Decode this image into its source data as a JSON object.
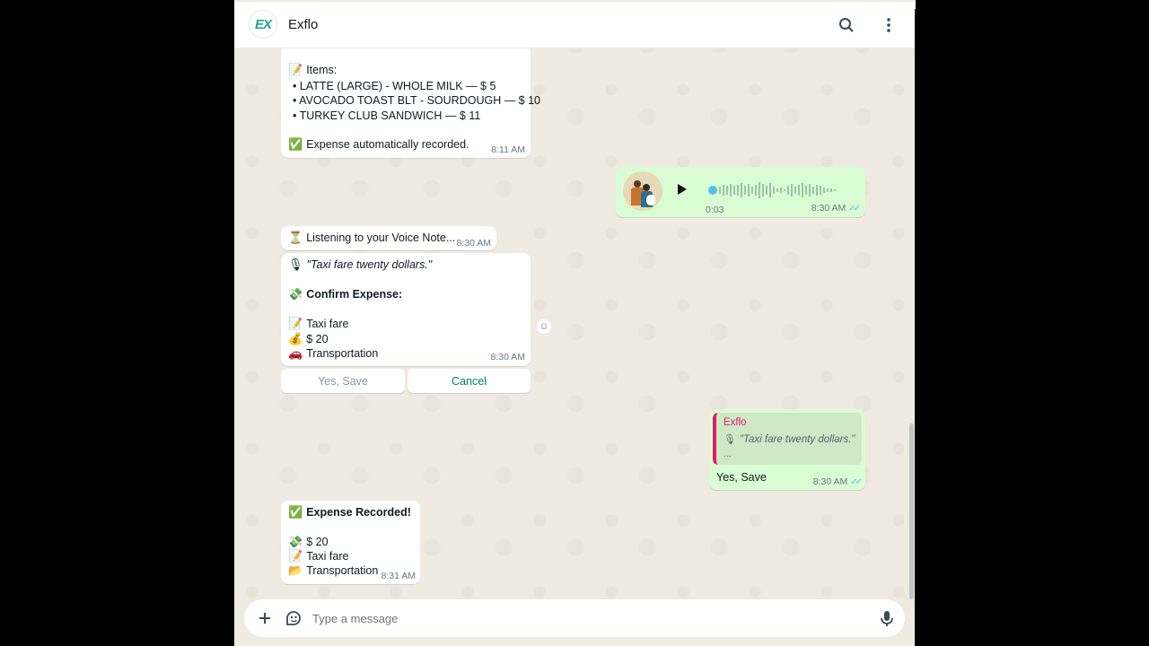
{
  "header": {
    "logo_text": "EX",
    "title": "Exflo",
    "search_icon": "search-icon",
    "menu_icon": "more-vertical-icon"
  },
  "messages": {
    "receipt": {
      "items_label": "Items:",
      "items": [
        "LATTE (LARGE) - WHOLE MILK — $ 5",
        "AVOCADO TOAST BLT - SOURDOUGH — $ 10",
        "TURKEY CLUB SANDWICH — $ 11"
      ],
      "recorded": "Expense automatically recorded.",
      "time": "8:11 AM"
    },
    "voice_note": {
      "duration": "0:03",
      "time": "8:30 AM"
    },
    "listening": {
      "text": "Listening to your Voice Note...",
      "time": "8:30 AM"
    },
    "confirm": {
      "transcript": "\"Taxi fare twenty dollars.\"",
      "heading": "Confirm Expense:",
      "description": "Taxi fare",
      "amount": "$ 20",
      "category": "Transportation",
      "time": "8:30 AM"
    },
    "buttons": {
      "yes": "Yes, Save",
      "cancel": "Cancel"
    },
    "reply": {
      "quoted_author": "Exflo",
      "quoted_text": "\"Taxi fare twenty dollars.\"",
      "quoted_more": "...",
      "text": "Yes, Save",
      "time": "8:30 AM"
    },
    "recorded": {
      "heading": "Expense Recorded!",
      "amount": "$ 20",
      "description": "Taxi fare",
      "category": "Transportation",
      "time": "8:31 AM"
    }
  },
  "composer": {
    "placeholder": "Type a message",
    "attach_icon": "plus-icon",
    "sticker_icon": "sticker-icon",
    "mic_icon": "microphone-icon"
  },
  "colors": {
    "chat_bg": "#efeae2",
    "outgoing_bubble": "#d9fdd3",
    "accent": "#008069",
    "quote_bar": "#e5186d"
  }
}
